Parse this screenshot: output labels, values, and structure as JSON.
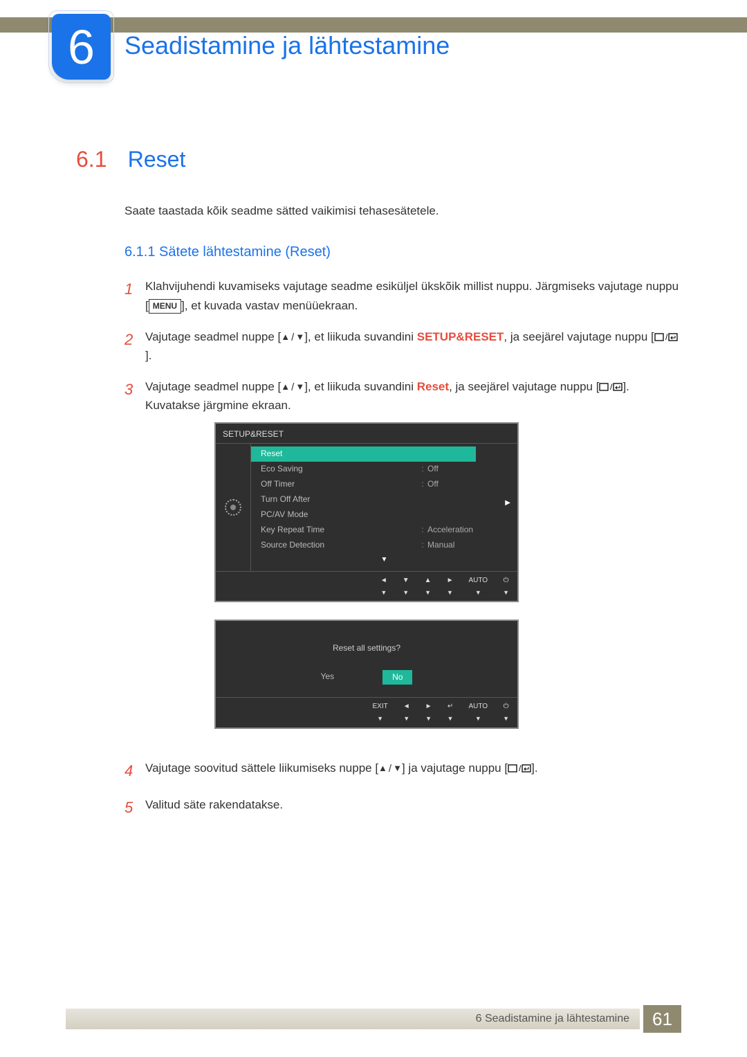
{
  "chapter": {
    "number": "6",
    "title": "Seadistamine ja lähtestamine"
  },
  "section": {
    "number": "6.1",
    "title": "Reset",
    "intro": "Saate taastada kõik seadme sätted vaikimisi tehasesätetele."
  },
  "subsection": {
    "number": "6.1.1",
    "title": "Sätete lähtestamine (Reset)"
  },
  "menu_label": "MENU",
  "setup_reset": "SETUP&RESET",
  "reset_label": "Reset",
  "steps": {
    "s1a": "Klahvijuhendi kuvamiseks vajutage seadme esiküljel ükskõik millist nuppu. Järgmiseks vajutage nuppu [",
    "s1b": "], et kuvada vastav menüüekraan.",
    "s2a": "Vajutage seadmel nuppe [",
    "s2b": "], et liikuda suvandini ",
    "s2c": ", ja seejärel vajutage nuppu [",
    "s2d": "].",
    "s3a": "Vajutage seadmel nuppe [",
    "s3b": "], et liikuda suvandini ",
    "s3c": ", ja seejärel vajutage nuppu [",
    "s3d": "]. Kuvatakse järgmine ekraan.",
    "s4a": "Vajutage soovitud sättele liikumiseks nuppe [",
    "s4b": "] ja vajutage nuppu [",
    "s4c": "].",
    "s5": "Valitud säte rakendatakse."
  },
  "osd": {
    "title": "SETUP&RESET",
    "items": [
      {
        "label": "Reset",
        "value": "",
        "selected": true
      },
      {
        "label": "Eco Saving",
        "value": "Off"
      },
      {
        "label": "Off Timer",
        "value": "Off"
      },
      {
        "label": "Turn Off After",
        "value": ""
      },
      {
        "label": "PC/AV Mode",
        "value": ""
      },
      {
        "label": "Key Repeat Time",
        "value": "Acceleration"
      },
      {
        "label": "Source Detection",
        "value": "Manual"
      }
    ],
    "footer": [
      "◄",
      "▼",
      "▲",
      "►",
      "AUTO",
      "⏻"
    ]
  },
  "osd2": {
    "question": "Reset all settings?",
    "yes": "Yes",
    "no": "No",
    "footer": [
      "EXIT",
      "◄",
      "►",
      "↵",
      "AUTO",
      "⏻"
    ]
  },
  "footer": {
    "text": "6 Seadistamine ja lähtestamine",
    "page": "61"
  }
}
